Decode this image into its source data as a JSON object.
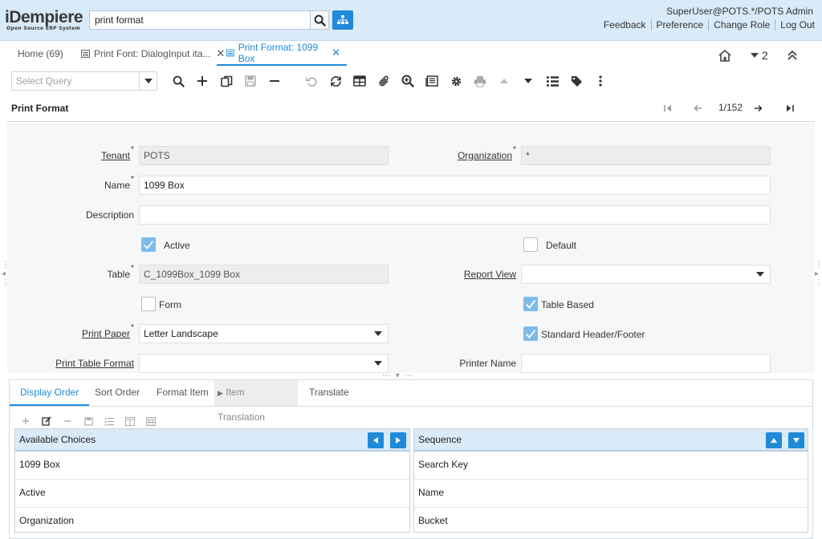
{
  "header": {
    "logo_main": "iDempiere",
    "logo_sub": "Open Source ERP System",
    "search_value": "print format",
    "user": "SuperUser@POTS.*/POTS Admin",
    "links": [
      "Feedback",
      "Preference",
      "Change Role",
      "Log Out"
    ]
  },
  "tabs": [
    {
      "label": "Home (69)"
    },
    {
      "label": "Print Font: DialogInput ita..."
    },
    {
      "label": "Print Format: 1099 Box"
    }
  ],
  "tabs_right": {
    "count": "2"
  },
  "toolbar": {
    "query_placeholder": "Select Query"
  },
  "window": {
    "title": "Print Format",
    "record": "1/152"
  },
  "form": {
    "tenant_label": "Tenant",
    "tenant_value": "POTS",
    "org_label": "Organization",
    "org_value": "*",
    "name_label": "Name",
    "name_value": "1099 Box",
    "description_label": "Description",
    "description_value": "",
    "active_label": "Active",
    "active_checked": true,
    "default_label": "Default",
    "default_checked": false,
    "table_label": "Table",
    "table_value": "C_1099Box_1099 Box",
    "report_view_label": "Report View",
    "report_view_value": "",
    "form_label": "Form",
    "form_checked": false,
    "table_based_label": "Table Based",
    "table_based_checked": true,
    "print_paper_label": "Print Paper",
    "print_paper_value": "Letter Landscape",
    "std_header_label": "Standard Header/Footer",
    "std_header_checked": true,
    "print_table_format_label": "Print Table Format",
    "print_table_format_value": "",
    "printer_name_label": "Printer Name",
    "printer_name_value": ""
  },
  "detail": {
    "tabs": [
      "Display Order",
      "Sort Order",
      "Format Item",
      "Item Translation",
      "Translate"
    ],
    "available": {
      "header": "Available Choices",
      "items": [
        "1099 Box",
        "Active",
        "Organization"
      ]
    },
    "sequence": {
      "header": "Sequence",
      "items": [
        "Search Key",
        "Name",
        "Bucket"
      ]
    }
  },
  "colors": {
    "accent": "#1f8ad8",
    "header_bg": "#d9eaf8",
    "checkbox_on": "#7dbcea"
  }
}
